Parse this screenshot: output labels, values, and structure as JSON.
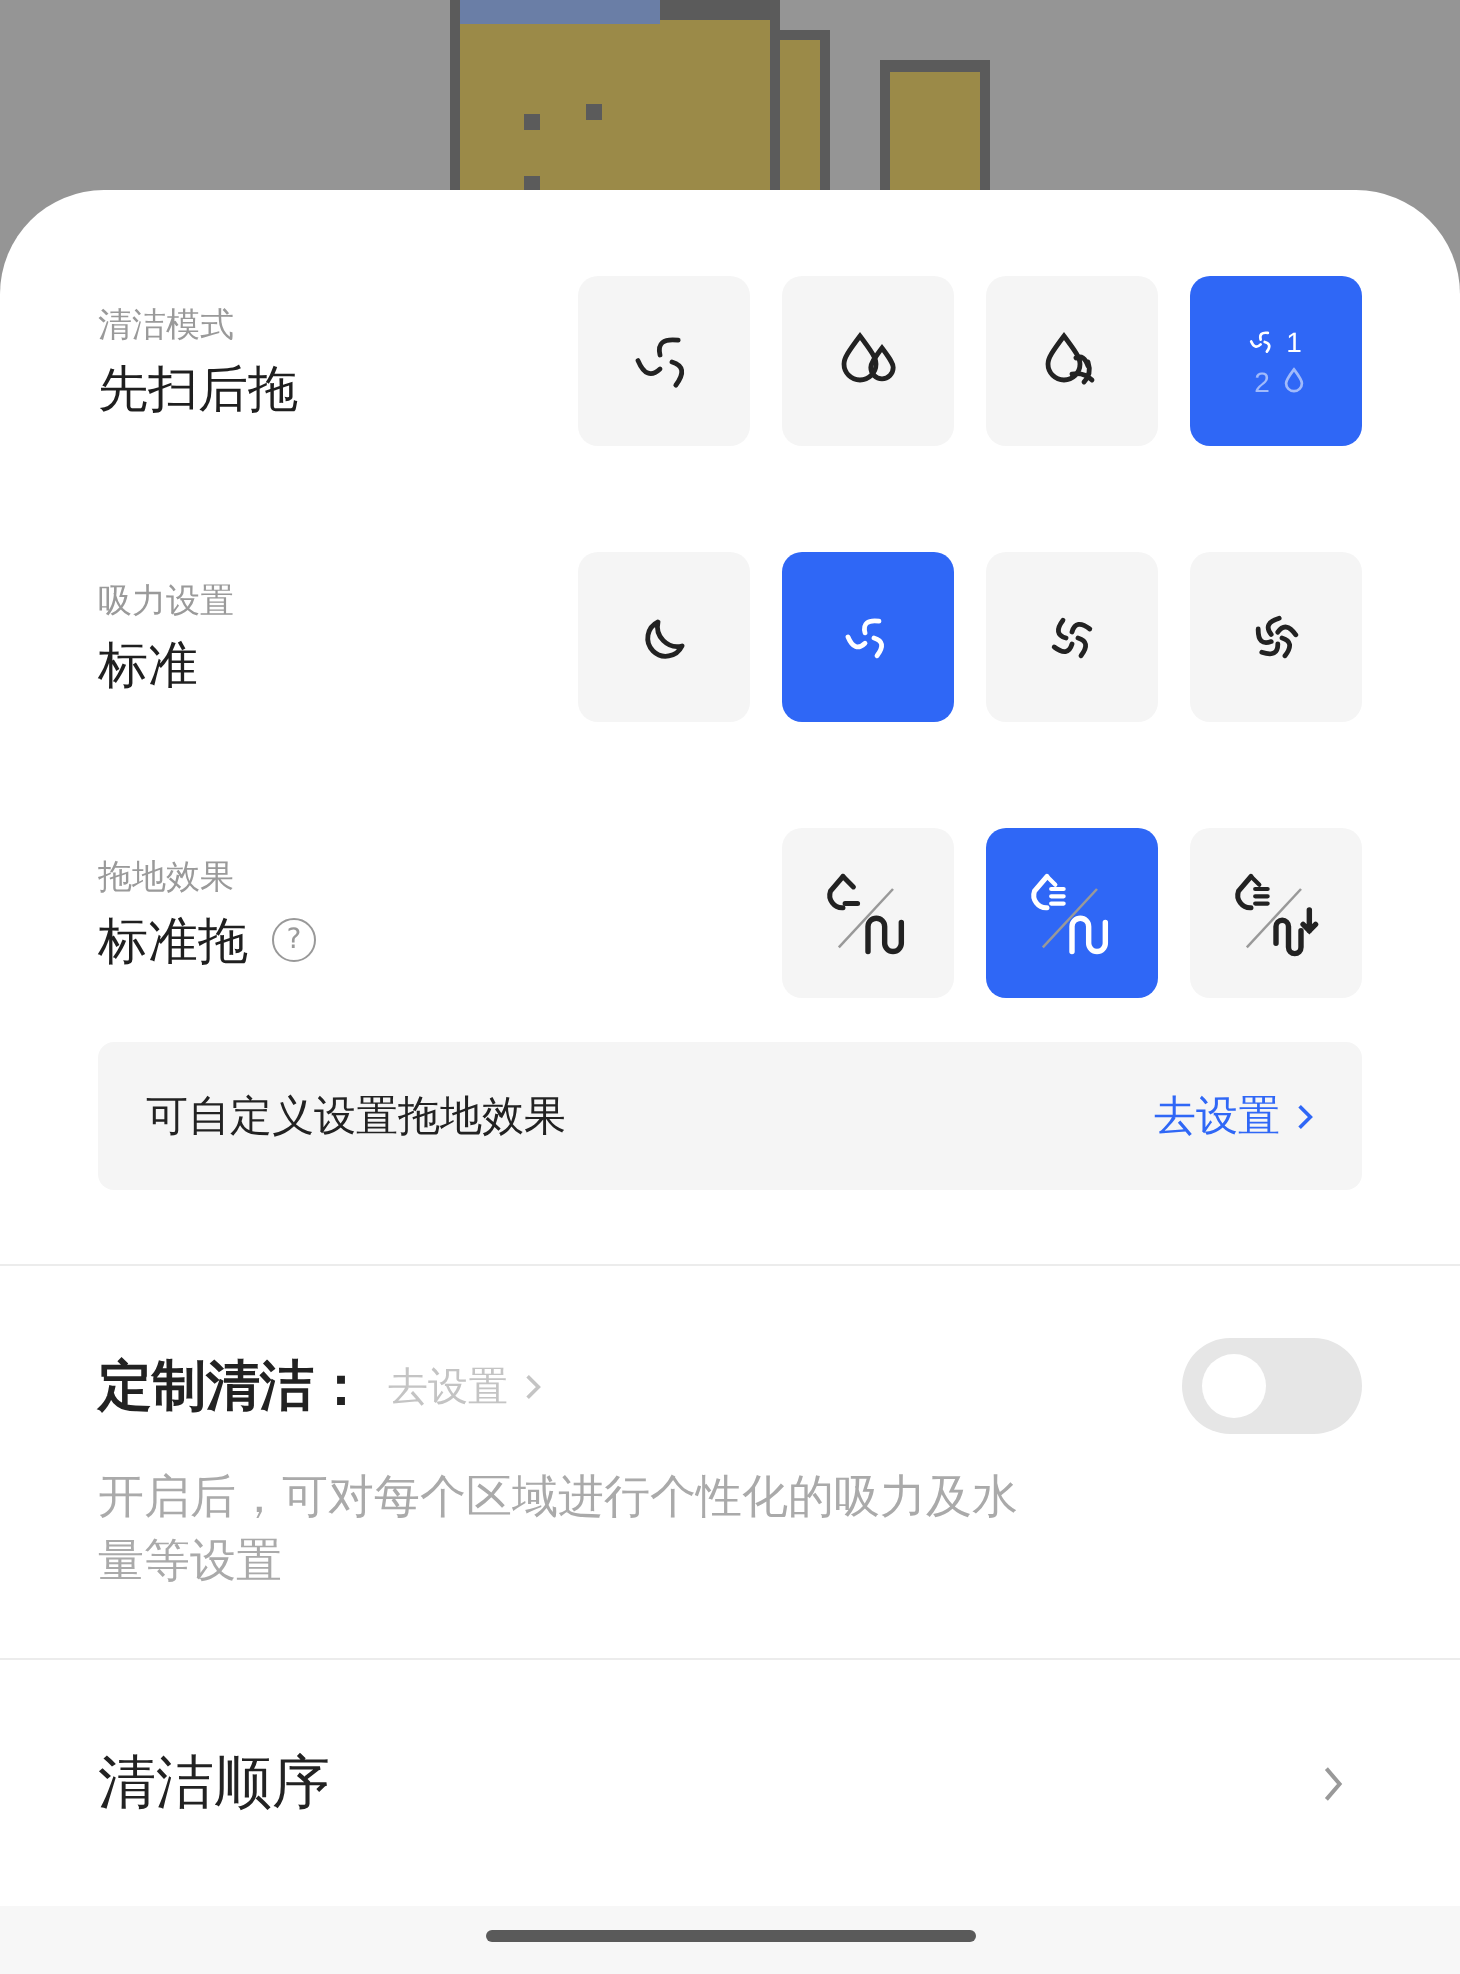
{
  "settings": [
    {
      "caption": "清洁模式",
      "value": "先扫后拖",
      "options": [
        {
          "kind": "sweep",
          "selected": false
        },
        {
          "kind": "mop",
          "selected": false
        },
        {
          "kind": "sweep_mop",
          "selected": false
        },
        {
          "kind": "sweep_then_mop",
          "selected": true,
          "step_labels": [
            "1",
            "2"
          ]
        }
      ]
    },
    {
      "caption": "吸力设置",
      "value": "标准",
      "options": [
        {
          "kind": "quiet",
          "selected": false
        },
        {
          "kind": "standard",
          "selected": true
        },
        {
          "kind": "strong",
          "selected": false
        },
        {
          "kind": "max",
          "selected": false
        }
      ]
    },
    {
      "caption": "拖地效果",
      "value": "标准拖",
      "help_icon": "?",
      "options": [
        {
          "kind": "light_mop",
          "selected": false
        },
        {
          "kind": "standard_mop",
          "selected": true
        },
        {
          "kind": "deep_mop",
          "selected": false
        }
      ]
    }
  ],
  "custom_mop": {
    "text": "可自定义设置拖地效果",
    "link": "去设置"
  },
  "custom_clean": {
    "title": "定制清洁：",
    "link": "去设置",
    "on": false,
    "description": "开启后，可对每个区域进行个性化的吸力及水量等设置"
  },
  "order": {
    "title": "清洁顺序"
  }
}
